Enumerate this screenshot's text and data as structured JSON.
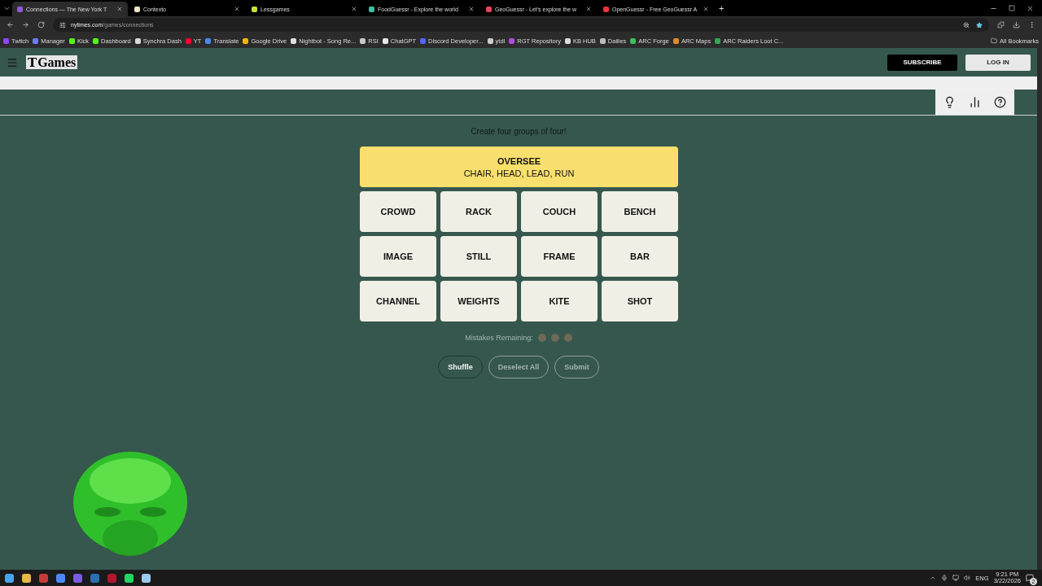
{
  "browser": {
    "tabs": [
      {
        "label": "Connections — The New York T",
        "selected": true,
        "color": "#8e5bd6"
      },
      {
        "label": "Contexto",
        "selected": false,
        "color": "#f0e6c8"
      },
      {
        "label": "Lessgames",
        "selected": false,
        "color": "#c6e23a"
      },
      {
        "label": "FoodGuessr - Explore the world",
        "selected": false,
        "color": "#3cc1a6"
      },
      {
        "label": "GeoGuessr - Let's explore the w",
        "selected": false,
        "color": "#e4445a"
      },
      {
        "label": "OpenGuessr - Free GeoGuessr A",
        "selected": false,
        "color": "#e8323c"
      }
    ],
    "new_tab": "+",
    "address_host": "nytimes.com",
    "address_path": "/games/connections",
    "bookmarks": [
      {
        "label": "Twitch",
        "color": "#9146ff"
      },
      {
        "label": "Manager",
        "color": "#6b7cff"
      },
      {
        "label": "Kick",
        "color": "#53fc18"
      },
      {
        "label": "Dashboard",
        "color": "#53fc18"
      },
      {
        "label": "Synchra Dash",
        "color": "#d8d8d8"
      },
      {
        "label": "YT",
        "color": "#ff0033"
      },
      {
        "label": "Translate",
        "color": "#4a8af4"
      },
      {
        "label": "Google Drive",
        "color": "#f4b400"
      },
      {
        "label": "Nightbot - Song Re...",
        "color": "#e0e0e0"
      },
      {
        "label": "RSI",
        "color": "#c8c8c8"
      },
      {
        "label": "ChatGPT",
        "color": "#e8e8e8"
      },
      {
        "label": "Discord Developer...",
        "color": "#5865f2"
      },
      {
        "label": "ytdl",
        "color": "#cccccc"
      },
      {
        "label": "RGT Repository",
        "color": "#b04bd8"
      },
      {
        "label": "KB HUB",
        "color": "#dddddd"
      },
      {
        "label": "Dailies",
        "color": "#bbbbbb"
      },
      {
        "label": "ARC Forge",
        "color": "#3bbf5a"
      },
      {
        "label": "ARC Maps",
        "color": "#e08a2a"
      },
      {
        "label": "ARC Raiders Loot C...",
        "color": "#34a853"
      }
    ],
    "all_bookmarks": "All Bookmarks"
  },
  "header": {
    "logo_mark": "T",
    "logo": "Games",
    "subscribe": "SUBSCRIBE",
    "login": "LOG IN"
  },
  "game": {
    "prompt": "Create four groups of four!",
    "solved": [
      {
        "title": "OVERSEE",
        "members": "CHAIR, HEAD, LEAD, RUN",
        "color": "#f9df6d"
      }
    ],
    "tiles": [
      {
        "word": "CROWD",
        "selected": false
      },
      {
        "word": "RACK",
        "selected": false
      },
      {
        "word": "COUCH",
        "selected": false
      },
      {
        "word": "BENCH",
        "selected": false
      },
      {
        "word": "IMAGE",
        "selected": false
      },
      {
        "word": "STILL",
        "selected": false
      },
      {
        "word": "FRAME",
        "selected": false
      },
      {
        "word": "BAR",
        "selected": false
      },
      {
        "word": "CHANNEL",
        "selected": false
      },
      {
        "word": "WEIGHTS",
        "selected": false
      },
      {
        "word": "KITE",
        "selected": false
      },
      {
        "word": "SHOT",
        "selected": false
      }
    ],
    "mistakes_label": "Mistakes Remaining:",
    "mistakes": [
      {
        "used": false
      },
      {
        "used": false
      },
      {
        "used": false
      }
    ],
    "actions": [
      {
        "label": "Shuffle",
        "disabled": false
      },
      {
        "label": "Deselect All",
        "disabled": true
      },
      {
        "label": "Submit",
        "disabled": true
      }
    ]
  },
  "taskbar": {
    "language": "ENG",
    "time": "9:21 PM",
    "date": "3/22/2026",
    "notifications": "2"
  }
}
